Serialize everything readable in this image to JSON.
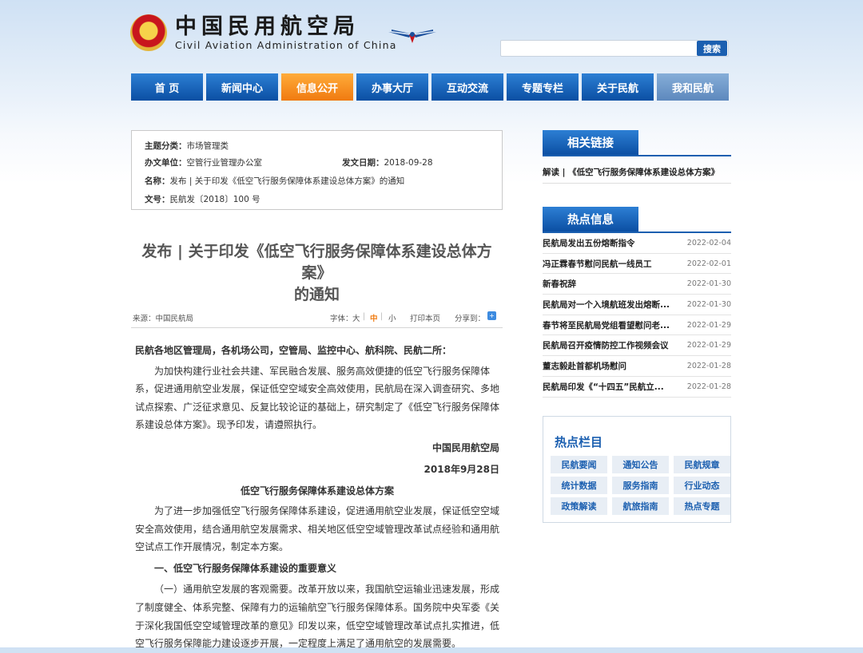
{
  "header": {
    "logo_cn": "中国民用航空局",
    "logo_en": "Civil Aviation Administration of China",
    "search_placeholder": "",
    "search_button": "搜索"
  },
  "nav": [
    "首 页",
    "新闻中心",
    "信息公开",
    "办事大厅",
    "互动交流",
    "专题专栏",
    "关于民航",
    "我和民航"
  ],
  "nav_active_index": 2,
  "meta": {
    "topic_label": "主题分类：",
    "topic": "市场管理类",
    "dept_label": "办文单位：",
    "dept": "空管行业管理办公室",
    "date_label": "发文日期：",
    "date": "2018-09-28",
    "name_label": "名称：",
    "name": "发布 | 关于印发《低空飞行服务保障体系建设总体方案》的通知",
    "doc_label": "文号：",
    "doc": "民航发〔2018〕100 号"
  },
  "article": {
    "title_line1": "发布 | 关于印发《低空飞行服务保障体系建设总体方案》",
    "title_line2": "的通知",
    "source": "来源：中国民航局",
    "font_label": "字体：",
    "font_large": "大",
    "font_medium": "中",
    "font_small": "小",
    "sep": "|",
    "print": "打印本页",
    "share": "分享到：",
    "paragraphs": [
      "民航各地区管理局，各机场公司，空管局、监控中心、航科院、民航二所：",
      "为加快构建行业社会共建、军民融合发展、服务高效便捷的低空飞行服务保障体系，促进通用航空业发展，保证低空空域安全高效使用，民航局在深入调查研究、多地试点探索、广泛征求意见、反复比较论证的基础上，研究制定了《低空飞行服务保障体系建设总体方案》。现予印发，请遵照执行。",
      "中国民用航空局",
      "2018年9月28日",
      "低空飞行服务保障体系建设总体方案",
      "为了进一步加强低空飞行服务保障体系建设，促进通用航空业发展，保证低空空域安全高效使用，结合通用航空发展需求、相关地区低空空域管理改革试点经验和通用航空试点工作开展情况，制定本方案。",
      "一、低空飞行服务保障体系建设的重要意义",
      "（一）通用航空发展的客观需要。改革开放以来，我国航空运输业迅速发展，形成了制度健全、体系完整、保障有力的运输航空飞行服务保障体系。国务院中央军委《关于深化我国低空空域管理改革的意见》印发以来，低空空域管理改革试点扎实推进，低空飞行服务保障能力建设逐步开展，一定程度上满足了通用航空的发展需要。"
    ]
  },
  "sidebar": {
    "links_title": "相关链接",
    "links": [
      "解读 | 《低空飞行服务保障体系建设总体方案》"
    ],
    "hot_title": "热点信息",
    "hot": [
      {
        "title": "民航局发出五份熔断指令",
        "date": "2022-02-04"
      },
      {
        "title": "冯正霖春节慰问民航一线员工",
        "date": "2022-02-01"
      },
      {
        "title": "新春祝辞",
        "date": "2022-01-30"
      },
      {
        "title": "民航局对一个入境航班发出熔断...",
        "date": "2022-01-30"
      },
      {
        "title": "春节将至民航局党组看望慰问老...",
        "date": "2022-01-29"
      },
      {
        "title": "民航局召开疫情防控工作视频会议",
        "date": "2022-01-29"
      },
      {
        "title": "董志毅赴首都机场慰问",
        "date": "2022-01-28"
      },
      {
        "title": "民航局印发《“十四五”民航立...",
        "date": "2022-01-28"
      }
    ],
    "columns_title": "热点栏目",
    "columns": [
      "民航要闻",
      "通知公告",
      "民航规章",
      "统计数据",
      "服务指南",
      "行业动态",
      "政策解读",
      "航旅指南",
      "热点专题"
    ]
  }
}
